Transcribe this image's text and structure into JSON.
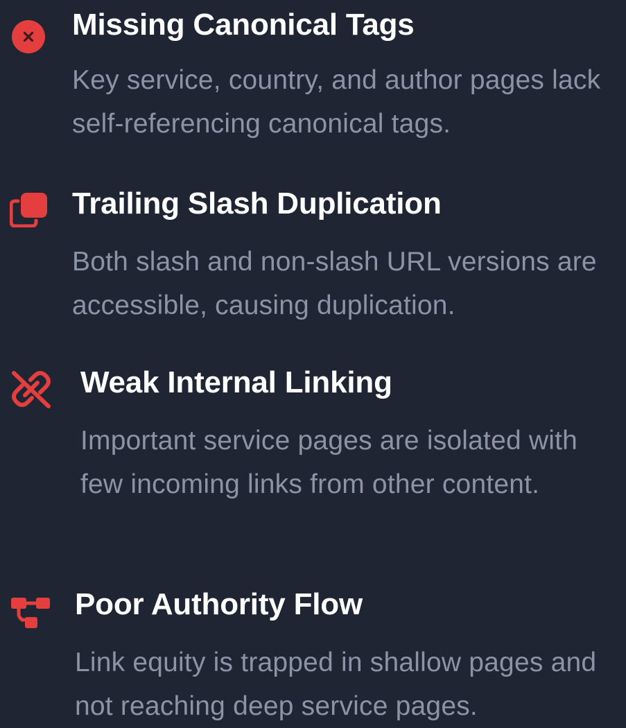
{
  "theme": {
    "background": "#1f2533",
    "accent": "#e53e3e",
    "title_color": "#ffffff",
    "description_color": "#8b94a5"
  },
  "issues": [
    {
      "icon": "x-circle-icon",
      "title": "Missing Canonical Tags",
      "description": "Key service, country, and author pages lack self-referencing canonical tags."
    },
    {
      "icon": "copy-duplicate-icon",
      "title": "Trailing Slash Duplication",
      "description": "Both slash and non-slash URL versions are accessible, causing duplication."
    },
    {
      "icon": "broken-link-icon",
      "title": "Weak Internal Linking",
      "description": "Important service pages are isolated with few incoming links from other content."
    },
    {
      "icon": "sitemap-icon",
      "title": "Poor Authority Flow",
      "description": "Link equity is trapped in shallow pages and not reaching deep service pages."
    }
  ]
}
